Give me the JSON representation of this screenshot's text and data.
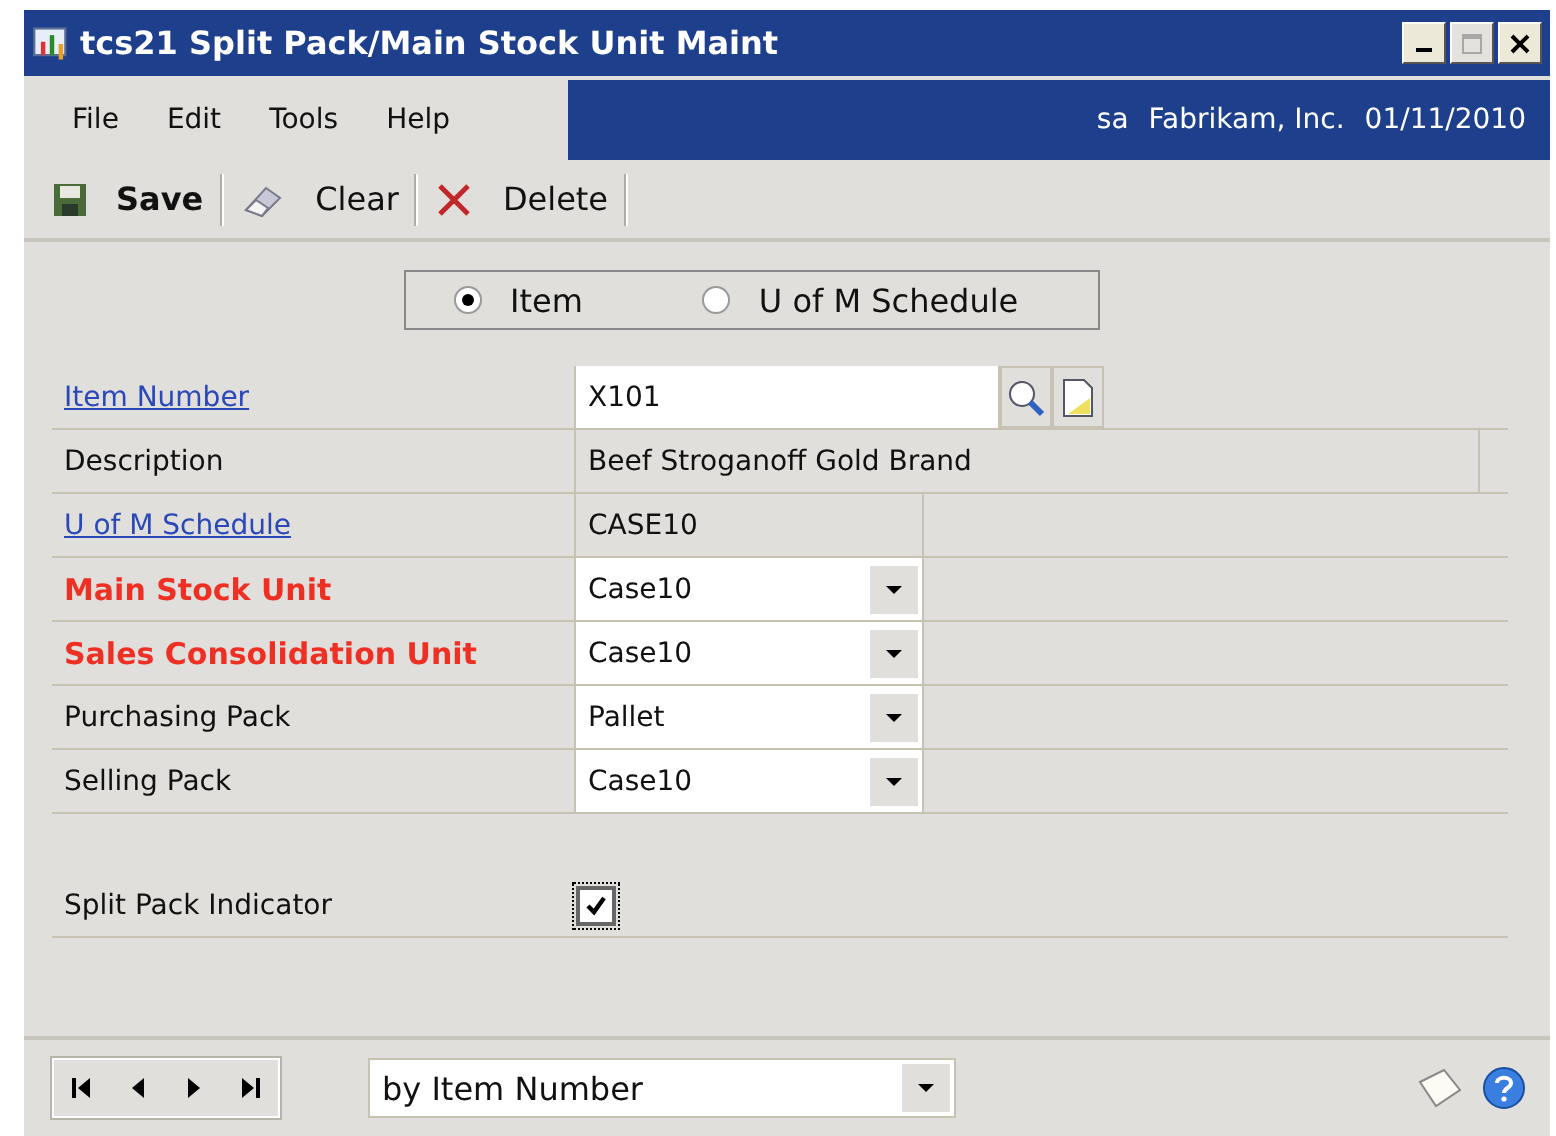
{
  "window": {
    "title": "tcs21 Split Pack/Main Stock Unit Maint",
    "maximize_disabled": true
  },
  "menu": [
    {
      "label": "File"
    },
    {
      "label": "Edit"
    },
    {
      "label": "Tools"
    },
    {
      "label": "Help"
    }
  ],
  "session": {
    "user": "sa",
    "company": "Fabrikam, Inc.",
    "date": "01/11/2010"
  },
  "toolbar": [
    {
      "kind": "save",
      "label": "Save"
    },
    {
      "kind": "clear",
      "label": "Clear"
    },
    {
      "kind": "delete",
      "label": "Delete"
    }
  ],
  "mode": [
    {
      "label": "Item",
      "selected": true
    },
    {
      "label": "U of M Schedule",
      "selected": false
    }
  ],
  "fields": [
    {
      "label": "Item Number",
      "link": true,
      "required": false,
      "kind": "lookup",
      "value": "X101"
    },
    {
      "label": "Description",
      "link": false,
      "required": false,
      "kind": "wide",
      "value": "Beef Stroganoff Gold Brand"
    },
    {
      "label": "U of M Schedule",
      "link": true,
      "required": false,
      "kind": "readonly",
      "value": "CASE10"
    },
    {
      "label": "Main Stock Unit",
      "link": false,
      "required": true,
      "kind": "dropdown",
      "value": "Case10"
    },
    {
      "label": "Sales Consolidation Unit",
      "link": false,
      "required": true,
      "kind": "dropdown",
      "value": "Case10"
    },
    {
      "label": "Purchasing Pack",
      "link": false,
      "required": false,
      "kind": "dropdown",
      "value": "Pallet"
    },
    {
      "label": "Selling Pack",
      "link": false,
      "required": false,
      "kind": "dropdown",
      "value": "Case10"
    }
  ],
  "split_pack": {
    "label": "Split Pack Indicator",
    "checked": true
  },
  "browse": {
    "sort": "by Item Number"
  }
}
